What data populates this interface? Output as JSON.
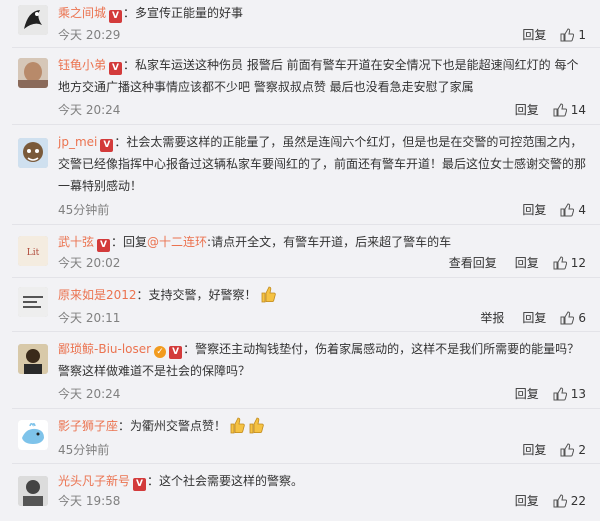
{
  "labels": {
    "reply": "回复",
    "view_reply": "查看回复",
    "report": "举报"
  },
  "comments": [
    {
      "user": "乘之间城",
      "text": "：多宣传正能量的好事",
      "time": "今天 20:29",
      "likes": "1"
    },
    {
      "user": "钰龟小弟",
      "text": "：私家车运送这种伤员 报警后 前面有警车开道在安全情况下也是能超速闯红灯的 每个地方交通广播这种事情应该都不少吧 警察叔叔点赞 最后也没看急走安慰了家属",
      "time": "今天 20:24",
      "likes": "14"
    },
    {
      "user": "jp_mei",
      "text": "：社会太需要这样的正能量了，虽然是连闯六个红灯，但是也是在交警的可控范围之内，交警已经像指挥中心报备过这辆私家车要闯红的了，前面还有警车开道！最后这位女士感谢交警的那一幕特别感动！",
      "time": "45分钟前",
      "likes": "4"
    },
    {
      "user": "武十弦",
      "text_pre": "：回复",
      "mention": "@十二连环",
      "text_post": ":请点开全文，有警车开道，后来超了警车的车",
      "time": "今天 20:02",
      "likes": "12"
    },
    {
      "user": "原来如是2012",
      "text": "：支持交警，好警察！",
      "time": "今天 20:11",
      "likes": "6"
    },
    {
      "user": "鄙琐鲸-Biu-loser",
      "text": "：警察还主动掏钱垫付，伤着家属感动的，这样不是我们所需要的能量吗？警察这样做难道不是社会的保障吗？",
      "time": "今天 20:24",
      "likes": "13"
    },
    {
      "user": "影子狮子座",
      "text": "：为衢州交警点赞！",
      "time": "45分钟前",
      "likes": "2"
    },
    {
      "user": "光头凡子新号",
      "text": "：这个社会需要这样的警察。",
      "time": "今天 19:58",
      "likes": "22"
    }
  ],
  "colors": {
    "username": "#eb7350",
    "mention": "#eb7350",
    "badge": "#d33b3b",
    "time": "#808080",
    "background": "#f2f2f5"
  }
}
